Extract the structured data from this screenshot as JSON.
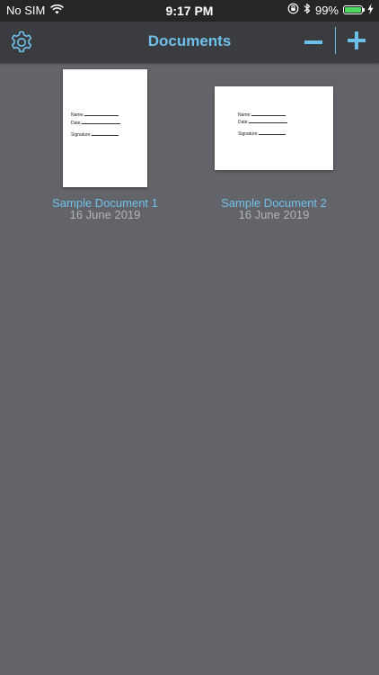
{
  "status_bar": {
    "carrier": "No SIM",
    "time": "9:17 PM",
    "battery_percent": "99%",
    "battery_level": 0.99,
    "icons": [
      "wifi-icon",
      "orientation-lock-icon",
      "bluetooth-icon",
      "battery-icon",
      "charging-icon"
    ]
  },
  "nav": {
    "title": "Documents",
    "settings_icon": "gear-icon",
    "remove_icon": "minus-icon",
    "add_icon": "plus-icon"
  },
  "colors": {
    "accent": "#6ec0ea",
    "background": "#636469",
    "nav_background": "#3b3c40",
    "date_text": "#b3b4b8"
  },
  "documents": [
    {
      "name": "Sample Document 1",
      "date": "16 June 2019",
      "orientation": "portrait",
      "thumb_fields": [
        "Name:",
        "Date:",
        "Signature:"
      ]
    },
    {
      "name": "Sample Document 2",
      "date": "16 June 2019",
      "orientation": "landscape",
      "thumb_fields": [
        "Name:",
        "Date:",
        "Signature:"
      ]
    }
  ]
}
